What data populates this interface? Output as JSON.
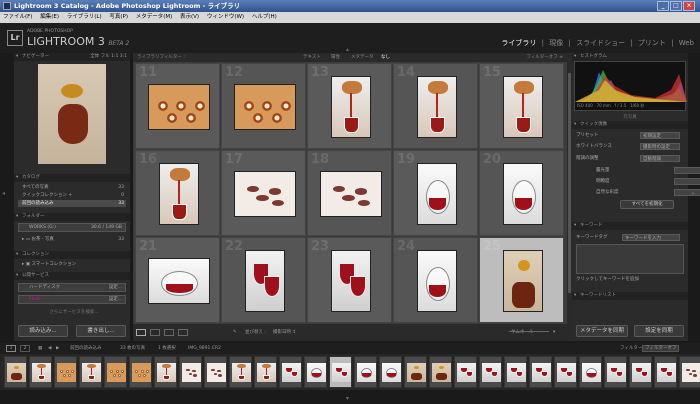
{
  "window": {
    "title": "Lightroom 3 Catalog - Adobe Photoshop Lightroom - ライブラリ",
    "minimize": "_",
    "maximize": "□",
    "close": "×"
  },
  "menu": [
    "ファイル(F)",
    "編集(E)",
    "ライブラリ(L)",
    "写真(P)",
    "メタデータ(M)",
    "表示(V)",
    "ウィンドウ(W)",
    "ヘルプ(H)"
  ],
  "brand": {
    "logo": "Lr",
    "sub": "ADOBE PHOTOSHOP",
    "name": "LIGHTROOM 3",
    "beta": "BETA 2"
  },
  "modules": [
    "ライブラリ",
    "現像",
    "スライドショー",
    "プリント",
    "Web"
  ],
  "module_separator": "|",
  "left": {
    "navigator": {
      "title": "ナビゲーター",
      "zoom": [
        "全体",
        "フル",
        "1:1",
        "3:1"
      ]
    },
    "catalog": {
      "title": "カタログ",
      "items": [
        {
          "label": "すべての写真",
          "count": "33"
        },
        {
          "label": "クイックコレクション +",
          "count": "0"
        },
        {
          "label": "前回の読み込み",
          "count": "33"
        }
      ]
    },
    "folders": {
      "title": "フォルダー",
      "volume": "WORKS (G:)",
      "volume_size": "30.6 / 149 GB",
      "items": [
        {
          "label": "お茶 - 写真",
          "count": "33"
        }
      ]
    },
    "collections": {
      "title": "コレクション",
      "items": [
        "スマートコレクション"
      ]
    },
    "publish": {
      "title": "公開サービス",
      "items": [
        {
          "label": "ハードディスク",
          "action": "設定..."
        },
        {
          "label": "Flickr",
          "action": "設定..."
        }
      ],
      "find_more": "さらにサービスを検索..."
    },
    "import_label": "読み込み...",
    "export_label": "書き出し..."
  },
  "filter": {
    "label": "ライブラリフィルター :",
    "tabs": [
      "テキスト",
      "属性",
      "メタデータ",
      "なし"
    ],
    "active": "なし",
    "off": "フィルターオフ ≑"
  },
  "grid": {
    "cells": [
      {
        "num": "11",
        "thumb": "tea-cups"
      },
      {
        "num": "12",
        "thumb": "tea-cups"
      },
      {
        "num": "13",
        "thumb": "pouring-tea"
      },
      {
        "num": "14",
        "thumb": "pouring-tea"
      },
      {
        "num": "15",
        "thumb": "pouring-tea"
      },
      {
        "num": "16",
        "thumb": "pouring-tea"
      },
      {
        "num": "17",
        "thumb": "dried-flowers"
      },
      {
        "num": "18",
        "thumb": "dried-flowers"
      },
      {
        "num": "19",
        "thumb": "glass-teapot"
      },
      {
        "num": "20",
        "thumb": "glass-teapot"
      },
      {
        "num": "21",
        "thumb": "glass-teapot"
      },
      {
        "num": "22",
        "thumb": "tea-glasses"
      },
      {
        "num": "23",
        "thumb": "tea-glasses"
      },
      {
        "num": "24",
        "thumb": "glass-teapot"
      },
      {
        "num": "25",
        "thumb": "honey-jar"
      }
    ],
    "selected_index": 14
  },
  "toolbar": {
    "sort_label": "並び替え :",
    "sort_value": "撮影日時 ↕",
    "thumbnail_label": "サムネール"
  },
  "right": {
    "histogram": {
      "title": "ヒストグラム",
      "iso": "ISO 400",
      "focal": "70 mm",
      "aperture": "f / 3.5",
      "shutter": "1/60 秒"
    },
    "original_label": "元写真",
    "quick_develop": {
      "title": "クイック現像",
      "preset": {
        "label": "プリセット",
        "value": "初期設定"
      },
      "white_balance": {
        "label": "ホワイトバランス",
        "value": "撮影時の設定"
      },
      "tone": {
        "label": "階調の調整",
        "value": "自動階調"
      },
      "rows": [
        "露光量",
        "明瞭度",
        "自然な彩度"
      ],
      "reset": "すべてを初期化"
    },
    "keywording": {
      "title": "キーワード",
      "tag_label": "キーワードタグ",
      "tag_value": "キーワードを入力",
      "hint": "クリックしてキーワードを追加"
    },
    "keyword_list": {
      "title": "キーワードリスト"
    },
    "sync_metadata": "メタデータを同期",
    "sync_settings": "設定を同期"
  },
  "filmstrip": {
    "pages": [
      "1",
      "2"
    ],
    "path": "前回の読み込み",
    "count": "33 枚の写真",
    "selected": "1 枚選択",
    "filename": "IMG_9891.CR2",
    "filter_label": "フィルター :",
    "filter_value": "フィルターオフ",
    "thumbs": [
      "honey-jar",
      "pouring-tea",
      "tea-cups",
      "pouring-tea",
      "tea-cups",
      "tea-cups",
      "pouring-tea",
      "dried-flowers",
      "dried-flowers",
      "pouring-tea",
      "pouring-tea",
      "tea-glasses",
      "glass-teapot",
      "tea-glasses",
      "glass-teapot",
      "glass-teapot",
      "honey-jar",
      "honey-jar",
      "tea-glasses",
      "tea-glasses",
      "tea-glasses",
      "tea-glasses",
      "tea-glasses",
      "glass-teapot",
      "tea-glasses",
      "tea-glasses",
      "tea-glasses",
      "dried-flowers"
    ],
    "selected_index": 13
  },
  "colors": {
    "accent": "#ffffff",
    "panel": "#2b2b2b",
    "grid": "#3c3c3c",
    "selected_cell": "#bdbdbd"
  }
}
